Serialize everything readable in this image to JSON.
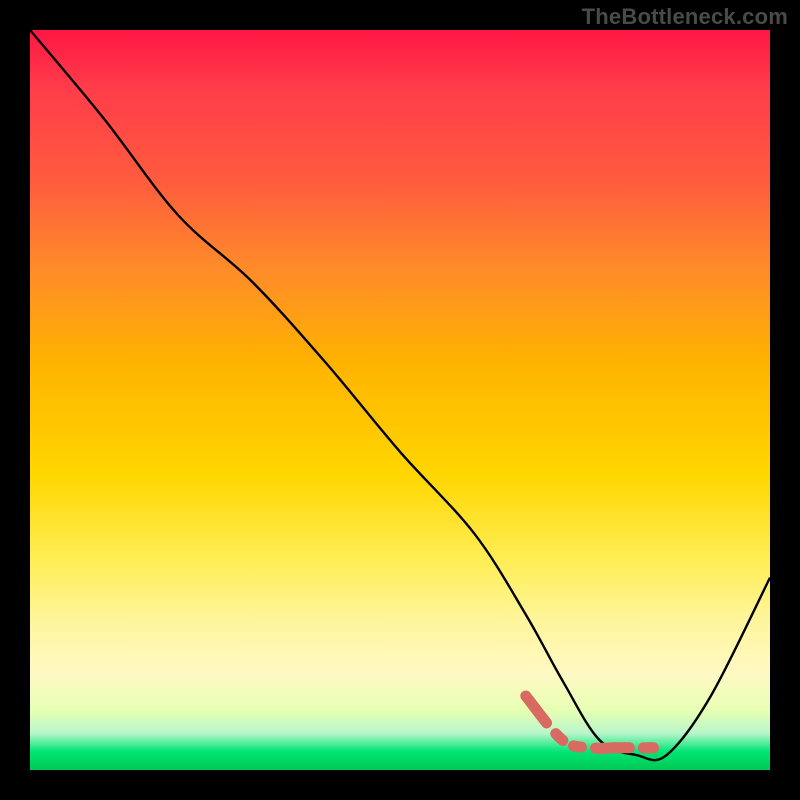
{
  "watermark": "TheBottleneck.com",
  "colors": {
    "curve": "#000000",
    "dash": "#d86a62",
    "background_frame": "#000000"
  },
  "chart_data": {
    "type": "line",
    "title": "",
    "xlabel": "",
    "ylabel": "",
    "xlim": [
      0,
      100
    ],
    "ylim": [
      0,
      100
    ],
    "grid": false,
    "series": [
      {
        "name": "bottleneck-curve",
        "x": [
          0,
          10,
          20,
          30,
          40,
          50,
          60,
          67,
          72,
          77,
          82,
          86,
          92,
          100
        ],
        "y": [
          100,
          88,
          75,
          66,
          55,
          43,
          32,
          21,
          12,
          4,
          2,
          2,
          10,
          26
        ]
      }
    ],
    "highlight_segment": {
      "name": "optimal-range-dash",
      "x": [
        67,
        72,
        76,
        79,
        82,
        85
      ],
      "y": [
        10,
        4,
        3,
        3,
        3,
        3
      ]
    }
  }
}
